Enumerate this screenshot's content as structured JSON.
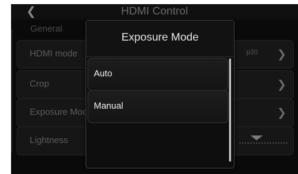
{
  "header": {
    "back_icon": "chevron-left-icon",
    "title": "HDMI Control"
  },
  "settings": {
    "section": "General",
    "rows": [
      {
        "label": "HDMI mode",
        "value": "p30"
      },
      {
        "label": "Crop"
      },
      {
        "label": "Exposure Mode"
      },
      {
        "label": "Lightness"
      }
    ]
  },
  "dialog": {
    "title": "Exposure Mode",
    "options": [
      {
        "label": "Auto"
      },
      {
        "label": "Manual"
      }
    ]
  },
  "colors": {
    "background": "#0a0a0a",
    "dialog_text": "#f0f0f0",
    "muted_text": "#5c5c5c"
  }
}
